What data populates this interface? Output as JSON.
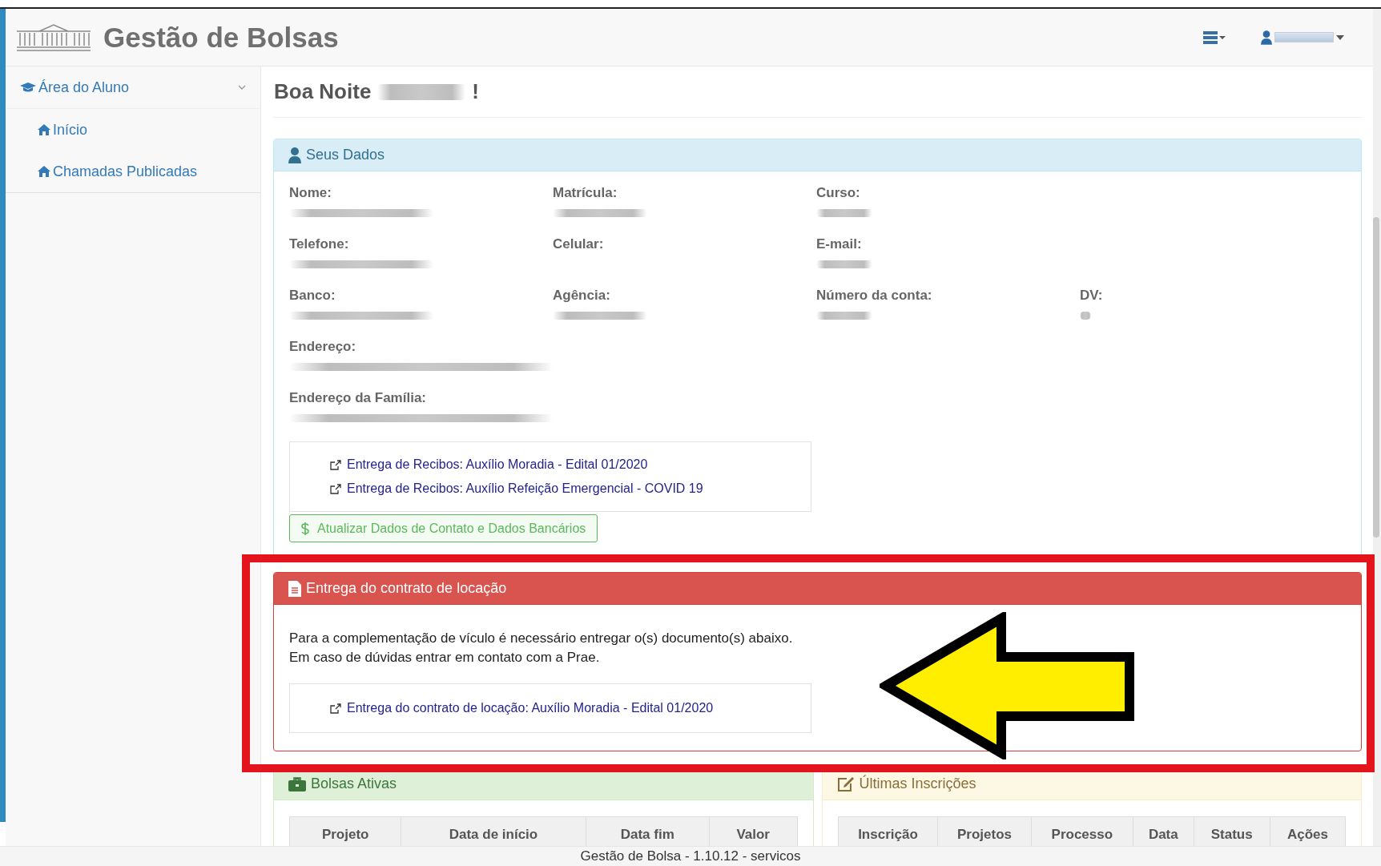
{
  "header": {
    "title": "Gestão de Bolsas"
  },
  "sidebar": {
    "items": [
      {
        "label": "Área do Aluno",
        "expanded": true,
        "children": [
          {
            "label": "Início"
          },
          {
            "label": "Chamadas Publicadas"
          }
        ]
      }
    ]
  },
  "greeting": {
    "text": "Boa Noite",
    "suffix": "!"
  },
  "panels": [
    {
      "kind": "info",
      "title": "Seus Dados",
      "field_rows": [
        [
          {
            "label": "Nome:",
            "redacted": true
          },
          {
            "label": "Matrícula:",
            "redacted": true
          },
          {
            "label": "Curso:",
            "redacted": true
          }
        ],
        [
          {
            "label": "Telefone:",
            "redacted": true
          },
          {
            "label": "Celular:",
            "redacted": false
          },
          {
            "label": "E-mail:",
            "redacted": true
          }
        ],
        [
          {
            "label": "Banco:",
            "redacted": true
          },
          {
            "label": "Agência:",
            "redacted": true
          },
          {
            "label": "Número da conta:",
            "redacted": true
          },
          {
            "label": "DV:",
            "redacted": true
          }
        ],
        [
          {
            "label": "Endereço:",
            "redacted": true
          }
        ],
        [
          {
            "label": "Endereço da Família:",
            "redacted": true
          }
        ]
      ],
      "links": [
        "Entrega de Recibos: Auxílio Moradia - Edital 01/2020",
        "Entrega de Recibos: Auxílio Refeição Emergencial - COVID 19"
      ],
      "button": "Atualizar Dados de Contato e Dados Bancários"
    },
    {
      "kind": "danger",
      "title": "Entrega do contrato de locação",
      "message": [
        "Para a complementação de vículo é necessário entregar o(s) documento(s) abaixo.",
        "Em caso de dúvidas entrar em contato com a Prae."
      ],
      "links": [
        "Entrega do contrato de locação: Auxílio Moradia - Edital 01/2020"
      ]
    }
  ],
  "bottom_panels": [
    {
      "kind": "success",
      "title": "Bolsas Ativas",
      "columns": [
        "Projeto",
        "Data de início",
        "Data fim",
        "Valor"
      ]
    },
    {
      "kind": "warning",
      "title": "Últimas Inscrições",
      "columns": [
        "Inscrição",
        "Projetos",
        "Processo",
        "Data",
        "Status",
        "Ações"
      ]
    }
  ],
  "footer": {
    "text": "Gestão de Bolsa - 1.10.12 - servicos"
  }
}
